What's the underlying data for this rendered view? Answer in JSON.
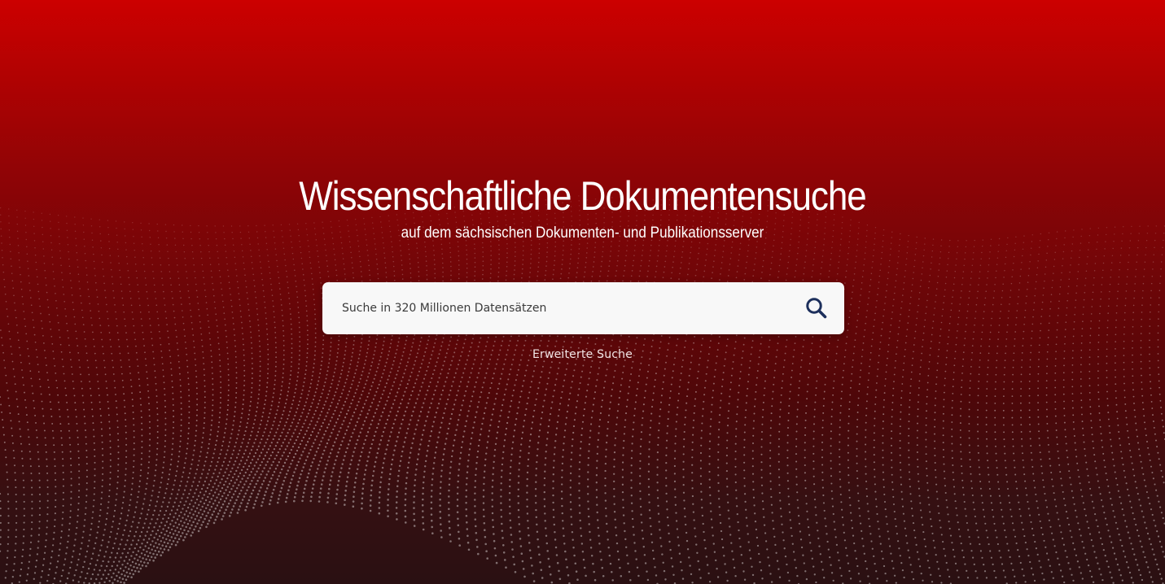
{
  "hero": {
    "title": "Wissenschaftliche Dokumentensuche",
    "subtitle": "auf dem sächsischen Dokumenten- und Publikationsserver"
  },
  "search": {
    "placeholder": "Suche in 320 Millionen Datensätzen",
    "value": "",
    "button_icon": "search-icon"
  },
  "advanced_search": {
    "label": "Erweiterte Suche"
  },
  "colors": {
    "background_top": "#cc0000",
    "background_bottom": "#2a1012",
    "search_box": "#f8f8f8",
    "search_icon": "#1d2f5c",
    "text": "#ffffff"
  }
}
